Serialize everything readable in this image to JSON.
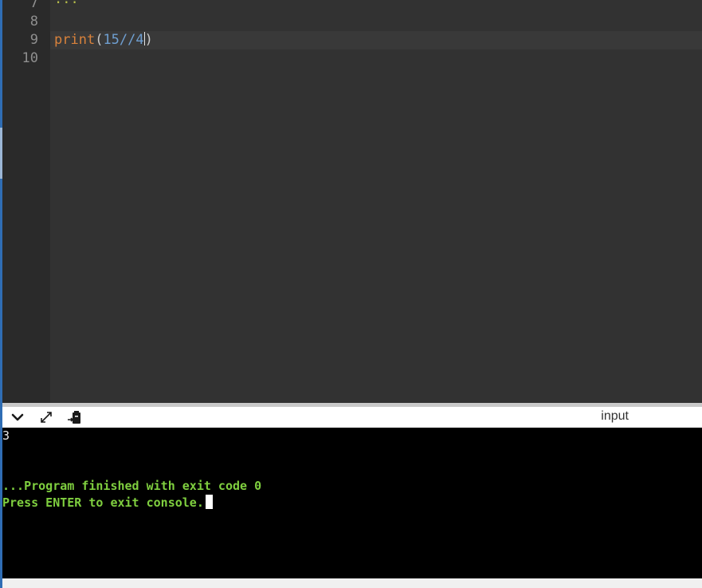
{
  "editor": {
    "lines": [
      {
        "number": "7",
        "partial_text": "..."
      },
      {
        "number": "8"
      },
      {
        "number": "9",
        "tokens": {
          "func": "print",
          "open": "(",
          "num1": "15",
          "op": "//",
          "num2": "4",
          "close": ")"
        }
      },
      {
        "number": "10"
      }
    ]
  },
  "toolbar": {
    "collapse_icon": "chevron-down-icon",
    "expand_icon": "expand-arrows-icon",
    "copy_icon": "clipboard-icon",
    "input_label": "input"
  },
  "console": {
    "output": "3",
    "finished_message": "...Program finished with exit code 0",
    "exit_prompt": "Press ENTER to exit console."
  },
  "colors": {
    "editor_bg": "#323232",
    "gutter_bg": "#2a2a2a",
    "keyword": "#d9823b",
    "number": "#6f9fd1",
    "console_bg": "#000000",
    "console_green": "#7fcf3f"
  }
}
